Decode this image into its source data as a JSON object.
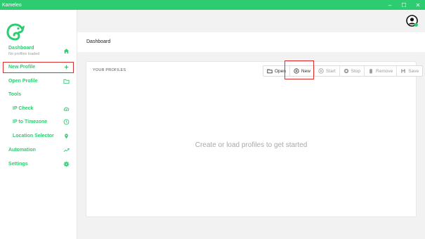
{
  "window": {
    "title": "Kameleo",
    "controls": [
      "–",
      "☐",
      "✕"
    ]
  },
  "colors": {
    "accent": "#2ecc71",
    "highlight": "#d93030"
  },
  "sidebar": {
    "items": [
      {
        "label": "Dashboard",
        "sublabel": "No profiles loaded",
        "icon": "home-icon"
      },
      {
        "label": "New Profile",
        "icon": "plus-icon"
      },
      {
        "label": "Open Profile",
        "icon": "folder-icon"
      },
      {
        "label": "Tools"
      },
      {
        "label": "IP Check",
        "icon": "cloud-check-icon"
      },
      {
        "label": "IP to Timezone",
        "icon": "clock-icon"
      },
      {
        "label": "Location Selector",
        "icon": "map-pin-icon"
      },
      {
        "label": "Automation",
        "icon": "trend-icon"
      },
      {
        "label": "Settings",
        "icon": "gear-icon"
      }
    ]
  },
  "header": {
    "title": "Dashboard"
  },
  "profiles": {
    "section_title": "YOUR PROFILES",
    "toolbar": {
      "open": "Open",
      "new": "New",
      "start": "Start",
      "stop": "Stop",
      "remove": "Remove",
      "save": "Save"
    },
    "empty_message": "Create or load profiles to get started"
  }
}
